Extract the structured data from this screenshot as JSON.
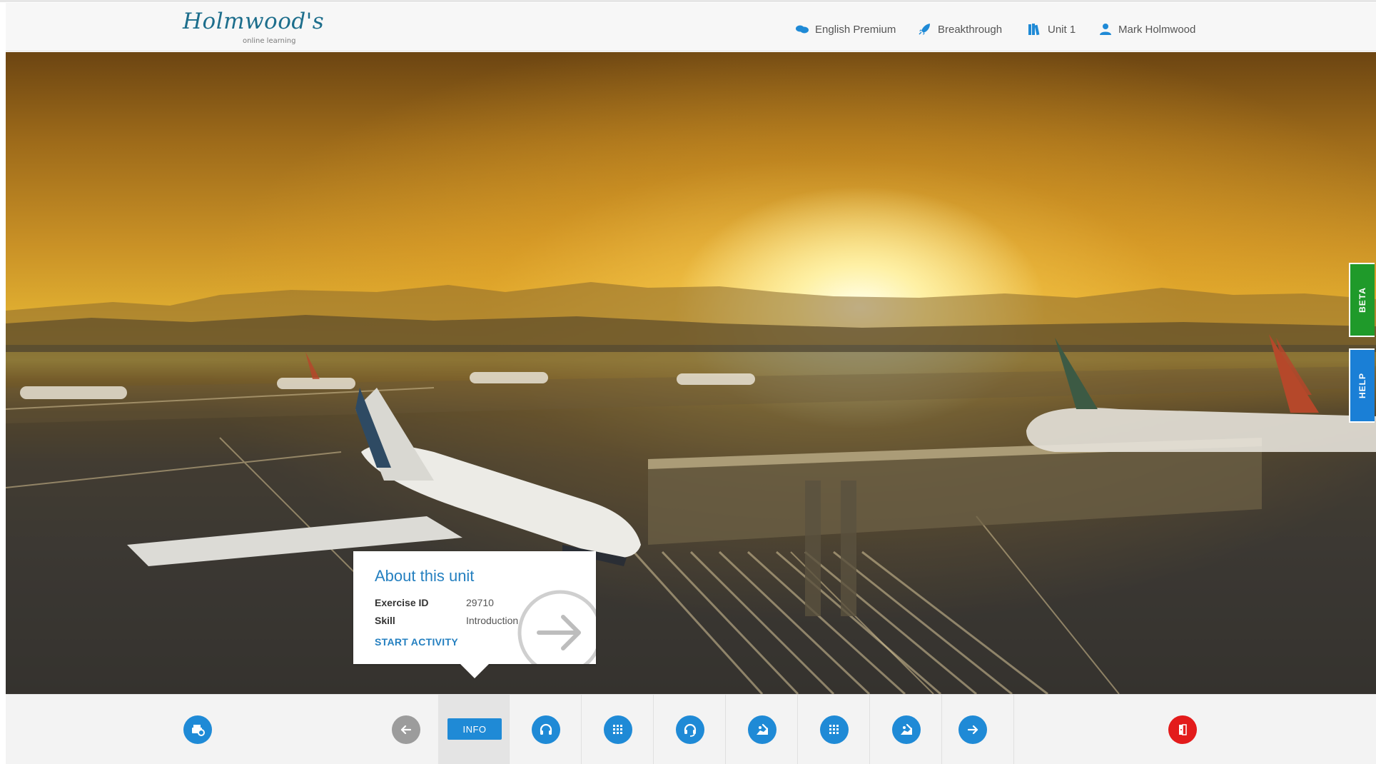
{
  "brand": {
    "logo_text": "Holmwood's",
    "logo_subtitle": "online learning",
    "color": "#1d6e8c"
  },
  "header": {
    "nav": [
      {
        "label": "English Premium",
        "icon": "chat-bubbles-icon"
      },
      {
        "label": "Breakthrough",
        "icon": "rocket-icon"
      },
      {
        "label": "Unit 1",
        "icon": "books-icon"
      },
      {
        "label": "Mark Holmwood",
        "icon": "user-icon"
      }
    ]
  },
  "side_tabs": {
    "beta": "BETA",
    "help": "HELP"
  },
  "unit_card": {
    "title": "About this unit",
    "fields": [
      {
        "key": "Exercise ID",
        "value": "29710"
      },
      {
        "key": "Skill",
        "value": "Introduction"
      }
    ],
    "start_label": "START ACTIVITY"
  },
  "toolbar": {
    "items": [
      {
        "icon": "print-settings-icon",
        "color": "#1f8ad6"
      },
      {
        "icon": "arrow-left-icon",
        "color": "#9c9c9c"
      },
      {
        "label": "INFO",
        "active": true
      },
      {
        "icon": "headphones-icon",
        "color": "#1f8ad6"
      },
      {
        "icon": "grid-exercise-icon",
        "color": "#1f8ad6"
      },
      {
        "icon": "headset-icon",
        "color": "#1f8ad6"
      },
      {
        "icon": "writing-hand-icon",
        "color": "#1f8ad6"
      },
      {
        "icon": "grid-exercise-icon",
        "color": "#1f8ad6"
      },
      {
        "icon": "writing-hand-icon",
        "color": "#1f8ad6"
      },
      {
        "icon": "arrow-right-icon",
        "color": "#1f8ad6"
      },
      {
        "icon": "exit-door-icon",
        "color": "#e31b1b"
      }
    ]
  },
  "colors": {
    "accent": "#1f8ad6",
    "beta": "#1f9a2a",
    "help": "#1a7fd6",
    "exit": "#e31b1b"
  }
}
